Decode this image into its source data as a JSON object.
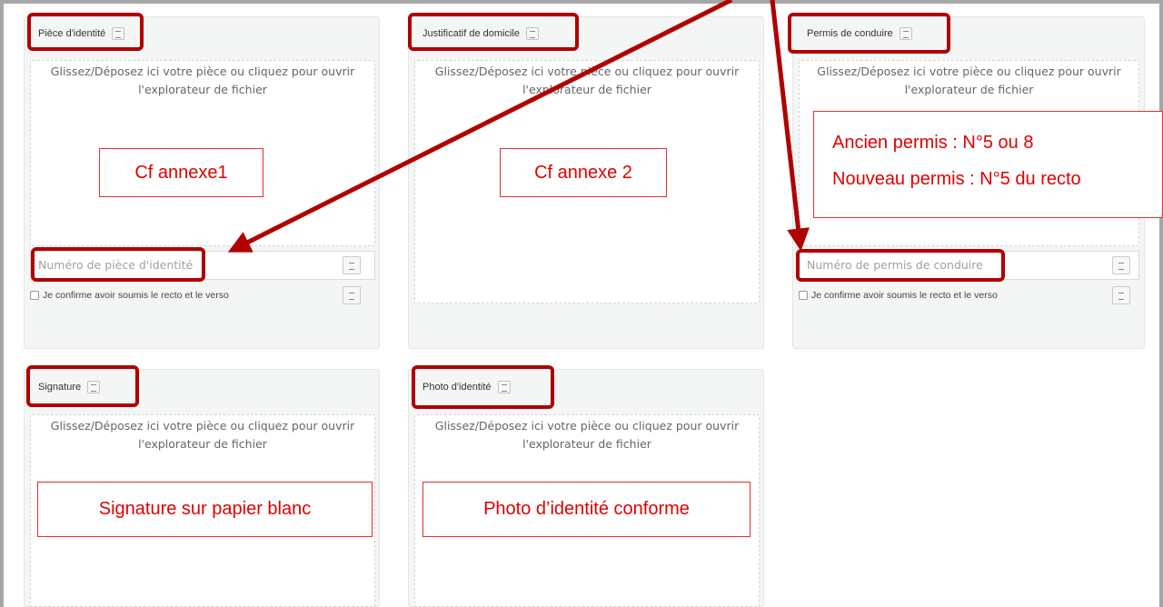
{
  "cards": [
    {
      "title": "Pièce d'identité",
      "dropzone_line1": "Glissez/Déposez ici votre pièce ou cliquez pour ouvrir",
      "dropzone_line2": "l'explorateur de fichier",
      "input_placeholder": "Numéro de pièce d'identité",
      "confirm_label": "Je confirme avoir soumis le recto et le verso"
    },
    {
      "title": "Justificatif de domicile",
      "dropzone_line1": "Glissez/Déposez ici votre pièce ou cliquez pour ouvrir",
      "dropzone_line2": "l'explorateur de fichier"
    },
    {
      "title": "Permis de conduire",
      "dropzone_line1": "Glissez/Déposez ici votre pièce ou cliquez pour ouvrir",
      "dropzone_line2": "l'explorateur de fichier",
      "input_placeholder": "Numéro de permis de conduire",
      "confirm_label": "Je confirme avoir soumis le recto et le verso"
    },
    {
      "title": "Signature",
      "dropzone_line1": "Glissez/Déposez ici votre pièce ou cliquez pour ouvrir",
      "dropzone_line2": "l'explorateur de fichier"
    },
    {
      "title": "Photo d'identité",
      "dropzone_line1": "Glissez/Déposez ici votre pièce ou cliquez pour ouvrir",
      "dropzone_line2": "l'explorateur de fichier"
    }
  ],
  "annotations": {
    "cf_annexe1": "Cf annexe1",
    "cf_annexe2": "Cf annexe 2",
    "permis_line1": "Ancien permis : N°5 ou 8",
    "permis_line2": "Nouveau permis : N°5 du recto",
    "signature_note": "Signature sur papier blanc",
    "photo_note": "Photo d’identité conforme"
  },
  "colors": {
    "annotation_red": "#b00000",
    "note_text_red": "#e00000",
    "card_bg": "#f4f5f5",
    "frame_gray": "#a6a6a6"
  }
}
